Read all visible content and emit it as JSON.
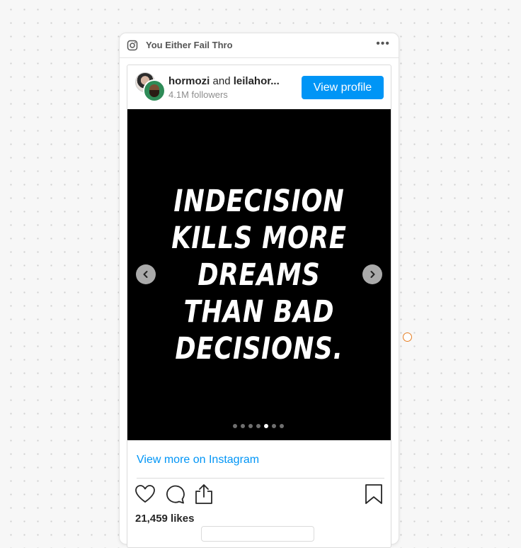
{
  "card": {
    "title": "You Either Fail Thro",
    "more_label": "•••"
  },
  "post": {
    "author": "hormozi",
    "connector": "and",
    "coauthor": "leilahor...",
    "followers": "4.1M followers",
    "view_profile_label": "View profile",
    "quote_lines": [
      "INDECISION",
      "KILLS MORE",
      "DREAMS",
      "THAN BAD",
      "DECISIONS."
    ],
    "carousel": {
      "total": 7,
      "active_index": 4
    },
    "view_more_label": "View more on Instagram",
    "likes": "21,459 likes"
  },
  "icons": {
    "header": "instagram-icon",
    "actions": [
      "heart-icon",
      "comment-icon",
      "share-icon",
      "bookmark-icon"
    ]
  },
  "colors": {
    "accent": "#0095f6",
    "marker": "#e67e22"
  }
}
